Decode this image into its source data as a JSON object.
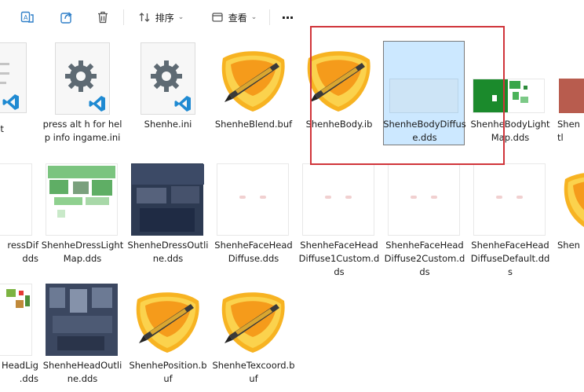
{
  "toolbar": {
    "sort_label": "排序",
    "view_label": "查看",
    "more_label": "···"
  },
  "files": {
    "r1c0": "txt",
    "r1c1": "press alt h for help info ingame.ini",
    "r1c2": "Shenhe.ini",
    "r1c3": "ShenheBlend.buf",
    "r1c4": "ShenheBody.ib",
    "r1c5": "ShenheBodyDiffuse.dds",
    "r1c6": "ShenheBodyLightMap.dds",
    "r1c7": "Shen\ntl",
    "r2c0": "ressDif\ndds",
    "r2c1": "ShenheDressLightMap.dds",
    "r2c2": "ShenheDressOutline.dds",
    "r2c3": "ShenheFaceHeadDiffuse.dds",
    "r2c4": "ShenheFaceHeadDiffuse1Custom.dds",
    "r2c5": "ShenheFaceHeadDiffuse2Custom.dds",
    "r2c6": "ShenheFaceHeadDiffuseDefault.dds",
    "r2c7": "Shen",
    "r3c0": "HeadLig\n.dds",
    "r3c1": "ShenheHeadOutline.dds",
    "r3c2": "ShenhePosition.buf",
    "r3c3": "ShenheTexcoord.buf"
  },
  "colors": {
    "selection": "#cce8ff",
    "highlight_box": "#d0343a",
    "vscode_blue": "#1f8ad2"
  }
}
